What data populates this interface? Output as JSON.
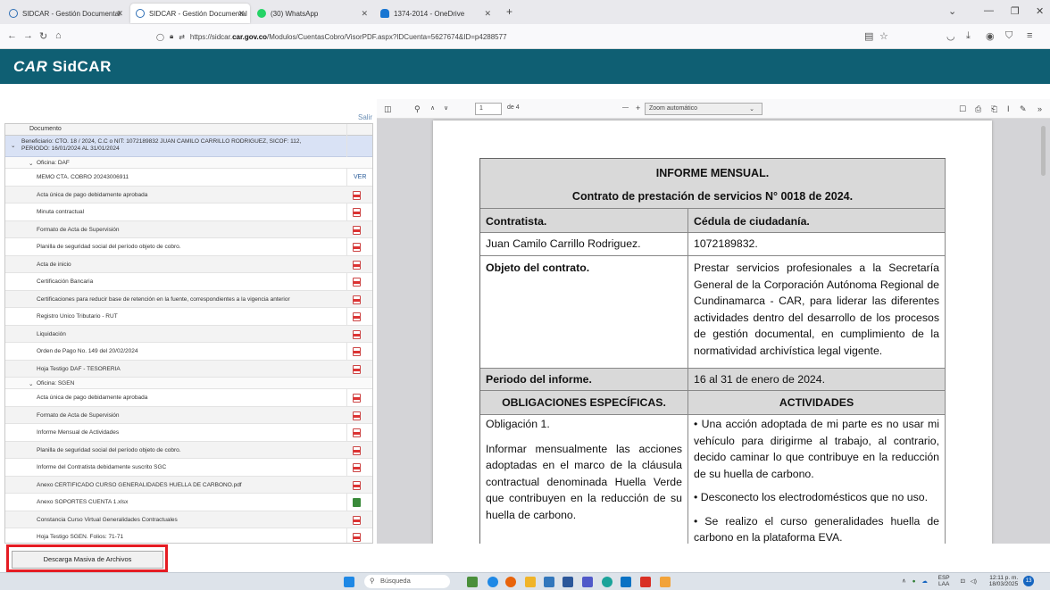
{
  "browser": {
    "tabs": [
      {
        "title": "SIDCAR - Gestión Documental",
        "color": "#2e6fb5",
        "active": false
      },
      {
        "title": "SIDCAR - Gestión Documental",
        "color": "#2e6fb5",
        "active": true
      },
      {
        "title": "(30) WhatsApp",
        "color": "#25d366",
        "active": false
      },
      {
        "title": "1374-2014 - OneDrive",
        "color": "#1976d2",
        "active": false
      }
    ],
    "new_tab": "+",
    "url_protocol": "https://sidcar.",
    "url_domain": "car.gov.co",
    "url_path": "/Modulos/CuentasCobro/VisorPDF.aspx?IDCuenta=5627674&ID=p4288577"
  },
  "app": {
    "logo_a": "CAR",
    "logo_b": "SidCAR",
    "salir": "Salir"
  },
  "doc_panel": {
    "column_header": "Documento",
    "beneficiary_line1": "Beneficiario: CTO. 18 / 2024, C.C o NIT: 1072189832 JUAN CAMILO CARRILLO RODRIGUEZ, SICOF: 112,",
    "beneficiary_line2": "PERIODO: 16/01/2024 AL 31/01/2024",
    "office_daf": "Oficina: DAF",
    "office_sgen": "Oficina: SGEN",
    "ver_label": "VER",
    "daf_docs": [
      "MEMO CTA. COBRO 20243006911",
      "Acta única de pago debidamente aprobada",
      "Minuta contractual",
      "Formato de Acta de Supervisión",
      "Planilla de seguridad social del período objeto de cobro.",
      "Acta de inicio",
      "Certificación Bancaria",
      "Certificaciones para reducir base de retención en la fuente, correspondientes a la vigencia anterior",
      "Registro Unico Tributario - RUT",
      "Liquidación",
      "Orden de Pago No. 149 del 20/02/2024",
      "Hoja Testigo DAF - TESORERIA"
    ],
    "sgen_docs": [
      "Acta única de pago debidamente aprobada",
      "Formato de Acta de Supervisión",
      "Informe Mensual de Actividades",
      "Planilla de seguridad social del período objeto de cobro.",
      "Informe del Contratista debidamente suscrito SGC",
      "Anexo CERTIFICADO CURSO GENERALIDADES HUELLA DE CARBONO.pdf",
      "Anexo SOPORTES CUENTA 1.xlsx",
      "Constancia Curso Virtual Generalidades Contractuales",
      "Hoja Testigo SGEN. Folios: 71-71"
    ],
    "download_button": "Descarga Masiva de Archivos"
  },
  "pdf_toolbar": {
    "page_current": "1",
    "page_total": "de 4",
    "zoom": "Zoom automático",
    "minus": "—",
    "plus": "+"
  },
  "report": {
    "title": "INFORME MENSUAL.",
    "subtitle": "Contrato de prestación de servicios N° 0018 de 2024.",
    "contratista_label": "Contratista.",
    "cedula_label": "Cédula de ciudadanía.",
    "contratista_name": "Juan Camilo Carrillo Rodriguez.",
    "cedula_value": "1072189832.",
    "objeto_label": "Objeto del contrato.",
    "objeto_text": "Prestar servicios profesionales a la Secretaría General de la Corporación Autónoma Regional de Cundinamarca - CAR, para liderar las diferentes actividades dentro del desarrollo de los procesos de gestión documental, en cumplimiento de la normatividad archivística legal vigente.",
    "periodo_label": "Periodo del informe.",
    "periodo_value": "16 al 31 de enero de 2024.",
    "obligaciones_header": "OBLIGACIONES ESPECÍFICAS.",
    "actividades_header": "ACTIVIDADES",
    "obligacion_title": "Obligación 1.",
    "obligacion_text": "Informar mensualmente las acciones adoptadas en el marco de la cláusula contractual denominada Huella Verde que contribuyen en la reducción de su huella de carbono.",
    "actividad_1": "• Una acción adoptada de mi parte es no usar mi vehículo para dirigirme al trabajo, al contrario, decido caminar lo que contribuye en la reducción de su huella de carbono.",
    "actividad_2": "• Desconecto los electrodomésticos que no uso.",
    "actividad_3": "• Se realizo el curso generalidades huella de carbono en la plataforma EVA."
  },
  "taskbar": {
    "search": "Búsqueda",
    "lang_1": "ESP",
    "lang_2": "LAA",
    "time": "12:11 p. m.",
    "date": "18/03/2025",
    "notif": "13"
  }
}
